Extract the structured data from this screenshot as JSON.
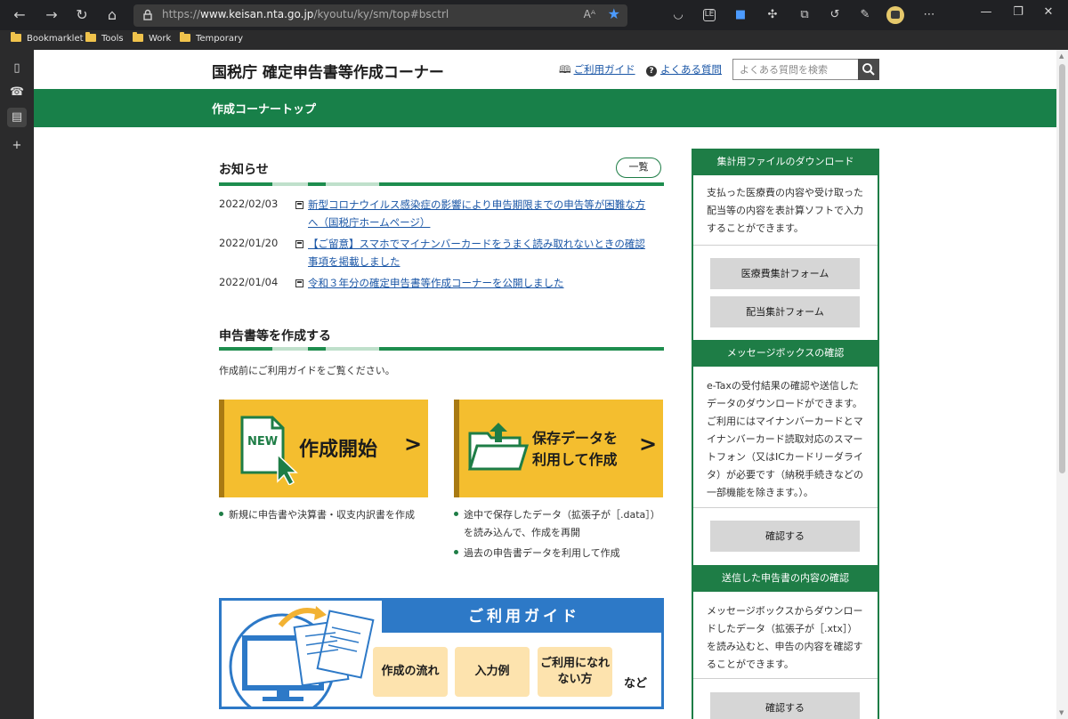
{
  "browser": {
    "url_prefix": "https://",
    "url_host": "www.keisan.nta.go.jp",
    "url_path": "/kyoutu/ky/sm/top#bsctrl",
    "read_aloud_label": "Aᴬ",
    "bookmarks": [
      "Bookmarklet",
      "Tools",
      "Work",
      "Temporary"
    ],
    "accent_color": "#4c9bff"
  },
  "header": {
    "site_title": "国税庁 確定申告書等作成コーナー",
    "guide_link": "ご利用ガイド",
    "faq_link": "よくある質問",
    "search_placeholder": "よくある質問を検索"
  },
  "green_bar": {
    "title": "作成コーナートップ",
    "color": "#188049"
  },
  "news": {
    "title": "お知らせ",
    "more_label": "一覧",
    "items": [
      {
        "date": "2022/02/03",
        "text": "新型コロナウイルス感染症の影響により申告期限までの申告等が困難な方へ（国税庁ホームページ）"
      },
      {
        "date": "2022/01/20",
        "text": "【ご留意】スマホでマイナンバーカードをうまく読み取れないときの確認事項を掲載しました"
      },
      {
        "date": "2022/01/04",
        "text": "令和３年分の確定申告書等作成コーナーを公開しました"
      }
    ]
  },
  "create": {
    "title": "申告書等を作成する",
    "intro": "作成前にご利用ガイドをご覧ください。",
    "start_card": {
      "badge": "NEW",
      "label": "作成開始"
    },
    "saved_card": {
      "label_line1": "保存データを",
      "label_line2": "利用して作成"
    },
    "start_bullets": [
      "新規に申告書や決算書・収支内訳書を作成"
    ],
    "saved_bullets": [
      "途中で保存したデータ（拡張子が［.data］）を読み込んで、作成を再開",
      "過去の申告書データを利用して作成"
    ]
  },
  "guide_banner": {
    "title": "ご利用ガイド",
    "btn1": "作成の流れ",
    "btn2": "入力例",
    "btn3": "ご利用になれない方",
    "etc": "など"
  },
  "sidebar": {
    "download": {
      "title": "集計用ファイルのダウンロード",
      "text": "支払った医療費の内容や受け取った配当等の内容を表計算ソフトで入力することができます。",
      "btn1": "医療費集計フォーム",
      "btn2": "配当集計フォーム"
    },
    "messagebox": {
      "title": "メッセージボックスの確認",
      "text": "e-Taxの受付結果の確認や送信したデータのダウンロードができます。ご利用にはマイナンバーカードとマイナンバーカード読取対応のスマートフォン（又はICカードリーダライタ）が必要です（納税手続きなどの一部機能を除きます。）。",
      "btn": "確認する"
    },
    "sent": {
      "title": "送信した申告書の内容の確認",
      "text": "メッセージボックスからダウンロードしたデータ（拡張子が［.xtx］）を読み込むと、申告の内容を確認することができます。",
      "btn": "確認する"
    }
  }
}
